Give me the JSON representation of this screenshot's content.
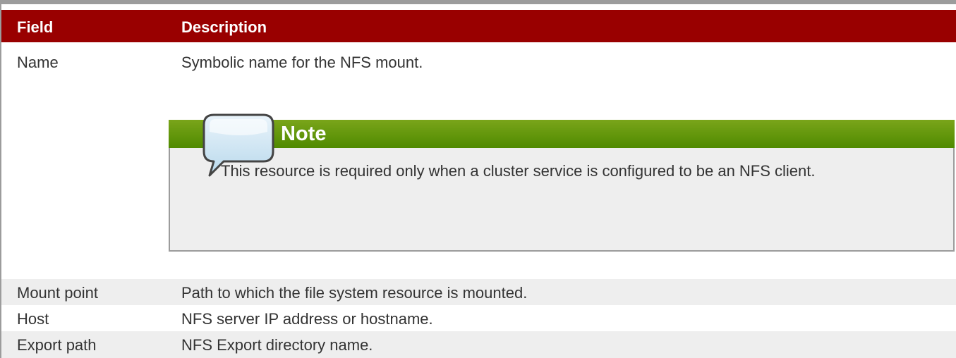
{
  "table": {
    "headers": {
      "field": "Field",
      "description": "Description"
    },
    "rows": [
      {
        "field": "Name",
        "description": "Symbolic name for the NFS mount."
      },
      {
        "field": "Mount point",
        "description": "Path to which the file system resource is mounted."
      },
      {
        "field": "Host",
        "description": "NFS server IP address or hostname."
      },
      {
        "field": "Export path",
        "description": "NFS Export directory name."
      }
    ]
  },
  "note": {
    "title": "Note",
    "text": "This resource is required only when a cluster service is configured to be an NFS client.",
    "icon": "speech-bubble-icon",
    "header_color": "#4f8a00"
  },
  "colors": {
    "header_bg": "#990000",
    "stripe_bg": "#eeeeee"
  }
}
